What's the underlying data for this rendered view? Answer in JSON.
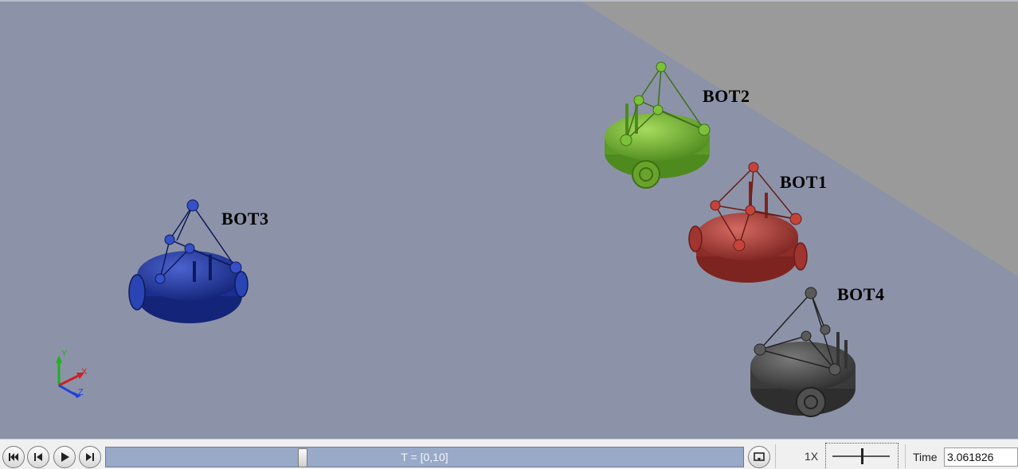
{
  "scene": {
    "robots": [
      {
        "id": "bot1",
        "label": "BOT1",
        "color": "#b03a35"
      },
      {
        "id": "bot2",
        "label": "BOT2",
        "color": "#76b03a"
      },
      {
        "id": "bot3",
        "label": "BOT3",
        "color": "#233ca8"
      },
      {
        "id": "bot4",
        "label": "BOT4",
        "color": "#4a4a4a"
      }
    ],
    "floor_color": "#8c93a8",
    "background_color": "#9a9a9a",
    "axes": {
      "x": "X",
      "y": "Y",
      "z": "Z",
      "x_color": "#d02020",
      "y_color": "#20b020",
      "z_color": "#2040e0"
    }
  },
  "playback": {
    "timeline_label": "T = [0,10]",
    "progress": 0.306,
    "speed_label": "1X",
    "time_label": "Time",
    "time_value": "3.061826",
    "buttons": {
      "skip_back": "skip-to-start-icon",
      "step_back": "step-back-icon",
      "play": "play-icon",
      "step_forward": "step-forward-icon",
      "loop": "loop-icon"
    }
  }
}
